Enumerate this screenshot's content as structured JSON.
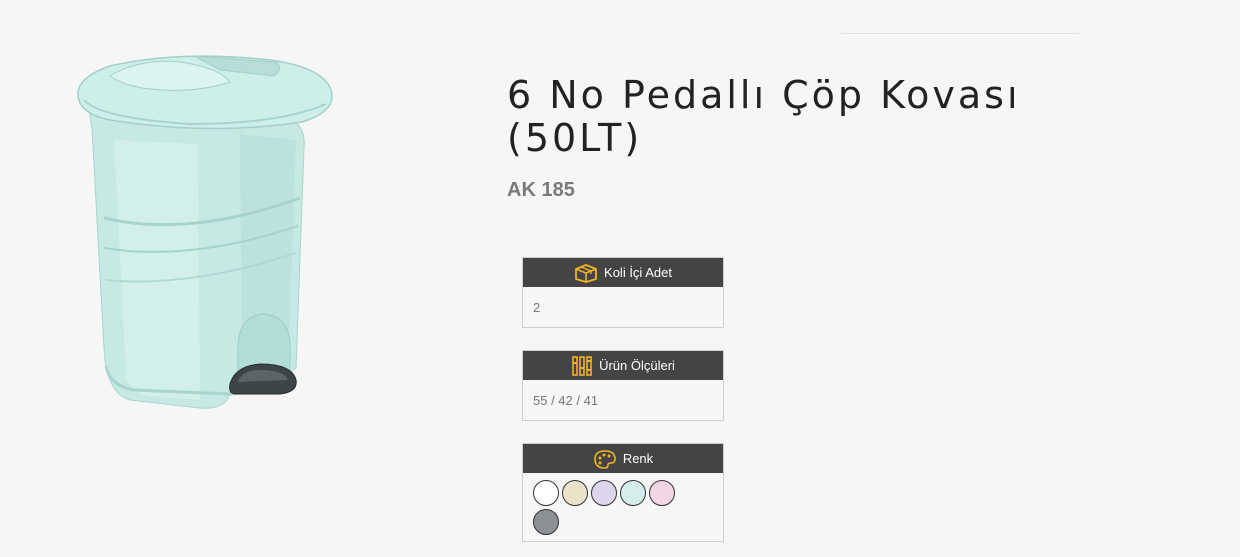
{
  "product": {
    "title": "6 No Pedallı Çöp Kovası (50LT)",
    "code": "AK 185"
  },
  "icons": {
    "product_image": "pedal-trash-bin-image",
    "koli": "box-icon",
    "olcu": "ruler-icon",
    "renk": "palette-icon"
  },
  "info": {
    "koli": {
      "label": "Koli İçi Adet",
      "value": "2"
    },
    "olcu": {
      "label": "Ürün Ölçüleri",
      "value": "55 / 42 / 41"
    },
    "renk": {
      "label": "Renk",
      "colors": [
        "#ffffff",
        "#eae3ca",
        "#ddd4ee",
        "#d4ecea",
        "#f3d6e6",
        "#8d9194"
      ]
    }
  },
  "colors": {
    "header_bg": "#444444",
    "icon_accent": "#f0b424",
    "product_body": "#c6e9e4"
  }
}
